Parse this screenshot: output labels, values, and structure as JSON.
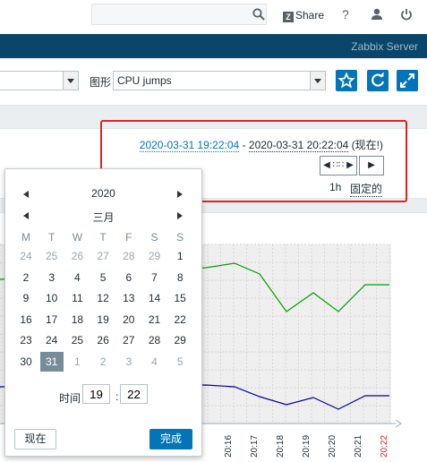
{
  "topbar": {
    "search_placeholder": "",
    "share_label": "Share",
    "share_logo": "Z",
    "help_label": "?"
  },
  "header": {
    "server_name": "Zabbix Server"
  },
  "filter": {
    "first_select_value": "",
    "graph_label": "图形",
    "graph_value": "CPU jumps"
  },
  "timeline": {
    "from": "2020-03-31 19:22:04",
    "separator": " - ",
    "to": "2020-03-31 20:22:04",
    "now_suffix": " (现在!)",
    "back_label": "◀ ∷∷ ▶",
    "forward_label": "▶",
    "zoom": "1h",
    "fixed_label": "固定的"
  },
  "calendar": {
    "year": "2020",
    "month": "三月",
    "weekdays": [
      "M",
      "T",
      "W",
      "T",
      "F",
      "S",
      "S"
    ],
    "weeks": [
      [
        {
          "d": "24",
          "o": true
        },
        {
          "d": "25",
          "o": true
        },
        {
          "d": "26",
          "o": true
        },
        {
          "d": "27",
          "o": true
        },
        {
          "d": "28",
          "o": true
        },
        {
          "d": "29",
          "o": true
        },
        {
          "d": "1"
        }
      ],
      [
        {
          "d": "2"
        },
        {
          "d": "3"
        },
        {
          "d": "4"
        },
        {
          "d": "5"
        },
        {
          "d": "6"
        },
        {
          "d": "7"
        },
        {
          "d": "8"
        }
      ],
      [
        {
          "d": "9"
        },
        {
          "d": "10"
        },
        {
          "d": "11"
        },
        {
          "d": "12"
        },
        {
          "d": "13"
        },
        {
          "d": "14"
        },
        {
          "d": "15"
        }
      ],
      [
        {
          "d": "16"
        },
        {
          "d": "17"
        },
        {
          "d": "18"
        },
        {
          "d": "19"
        },
        {
          "d": "20"
        },
        {
          "d": "21"
        },
        {
          "d": "22"
        }
      ],
      [
        {
          "d": "23"
        },
        {
          "d": "24"
        },
        {
          "d": "25"
        },
        {
          "d": "26"
        },
        {
          "d": "27"
        },
        {
          "d": "28"
        },
        {
          "d": "29"
        }
      ],
      [
        {
          "d": "30"
        },
        {
          "d": "31",
          "sel": true
        },
        {
          "d": "1",
          "o": true
        },
        {
          "d": "2",
          "o": true
        },
        {
          "d": "3",
          "o": true
        },
        {
          "d": "4",
          "o": true
        },
        {
          "d": "5",
          "o": true
        }
      ]
    ],
    "time_label": "时间",
    "hour": "19",
    "minute": "22",
    "now_button": "现在",
    "done_button": "完成"
  },
  "graph": {
    "x_labels": [
      "20:16",
      "20:17",
      "20:18",
      "20:19",
      "20:20",
      "20:21",
      "20:22"
    ],
    "x_label_colors": [
      "#1f2c33",
      "#1f2c33",
      "#1f2c33",
      "#1f2c33",
      "#1f2c33",
      "#1f2c33",
      "#e02424"
    ]
  },
  "colors": {
    "accent": "#0275b8",
    "header": "#0a466a",
    "highlight": "#e02424",
    "series_green": "#00a000",
    "series_blue": "#0000a0"
  }
}
